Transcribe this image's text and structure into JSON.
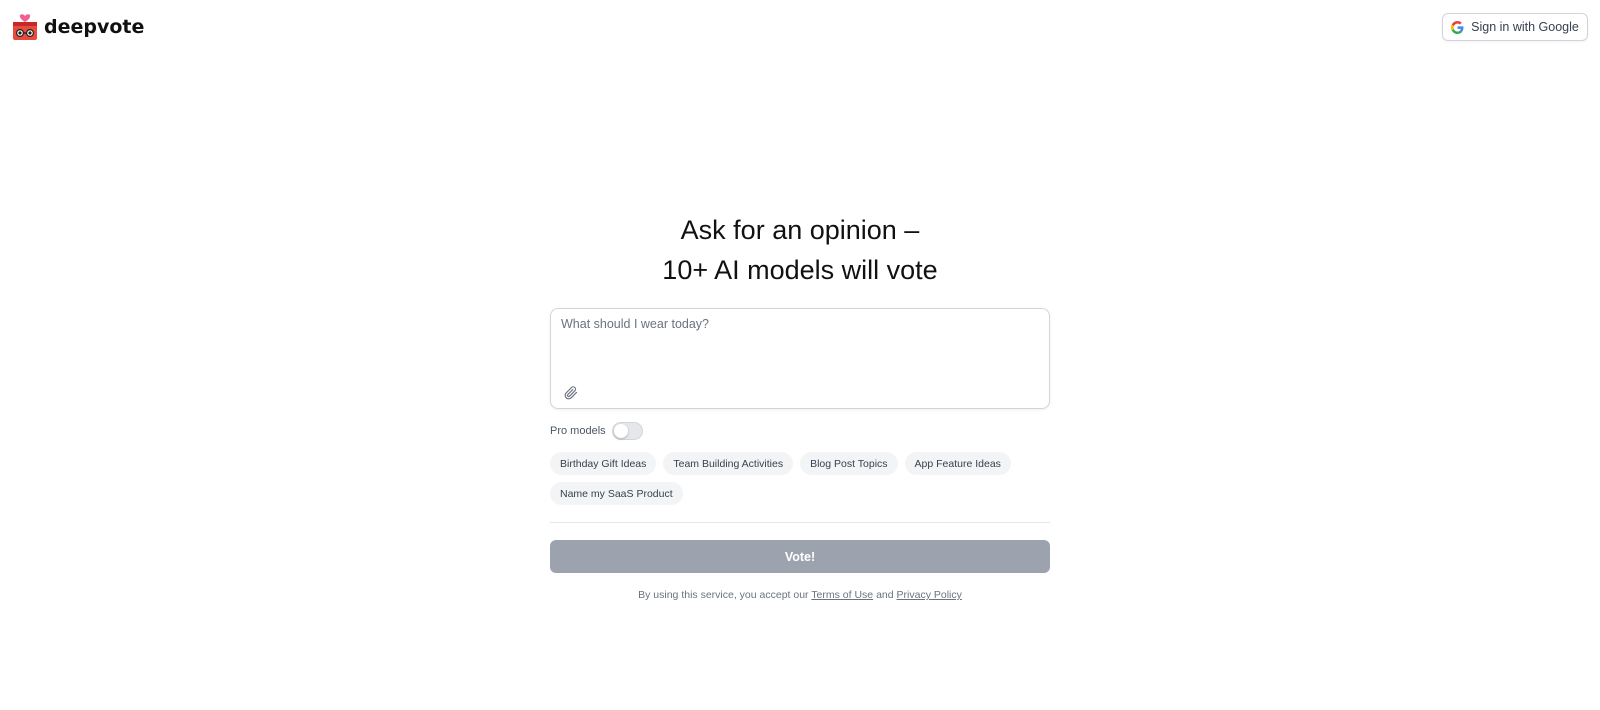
{
  "header": {
    "brand": "deepvote",
    "signin_label": "Sign in with Google"
  },
  "hero": {
    "line1": "Ask for an opinion –",
    "line2": "10+ AI models will vote"
  },
  "prompt": {
    "placeholder": "What should I wear today?",
    "value": ""
  },
  "pro_models": {
    "label": "Pro models",
    "enabled": false
  },
  "suggestions": [
    "Birthday Gift Ideas",
    "Team Building Activities",
    "Blog Post Topics",
    "App Feature Ideas",
    "Name my SaaS Product"
  ],
  "vote_label": "Vote!",
  "footer": {
    "prefix": "By using this service, you accept our",
    "terms_link": "Terms of Use",
    "and": "and",
    "privacy_link": "Privacy Policy"
  },
  "colors": {
    "brand_red": "#e84a3c",
    "brand_pink": "#f06292",
    "vote_disabled": "#9ca3af"
  },
  "icons": [
    "google-icon",
    "paperclip-icon",
    "deepvote-logo"
  ]
}
